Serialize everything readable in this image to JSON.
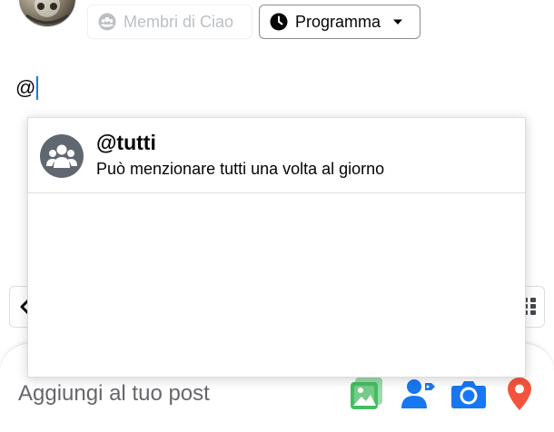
{
  "header": {
    "audience_chip": {
      "label": "Membri di Ciao",
      "icon": "group-icon"
    },
    "schedule_chip": {
      "label": "Programma",
      "icon": "clock-icon",
      "caret": "caret-down-icon"
    }
  },
  "composer": {
    "text": "@"
  },
  "mention_popup": {
    "suggestion": {
      "title": "@tutti",
      "subtitle": "Può menzionare tutti una volta al giorno",
      "icon": "group-icon"
    }
  },
  "bottom_bar": {
    "label": "Aggiungi al tuo post",
    "tools": [
      {
        "name": "photo-icon",
        "color": "#45bd62"
      },
      {
        "name": "tag-people-icon",
        "color": "#1877f2"
      },
      {
        "name": "camera-icon",
        "color": "#1877f2"
      },
      {
        "name": "location-icon",
        "color": "#f5533d"
      }
    ]
  },
  "colors": {
    "accent": "#1877f2",
    "text_primary": "#050505",
    "text_secondary": "#65676b",
    "disabled": "#bcc0c4"
  }
}
